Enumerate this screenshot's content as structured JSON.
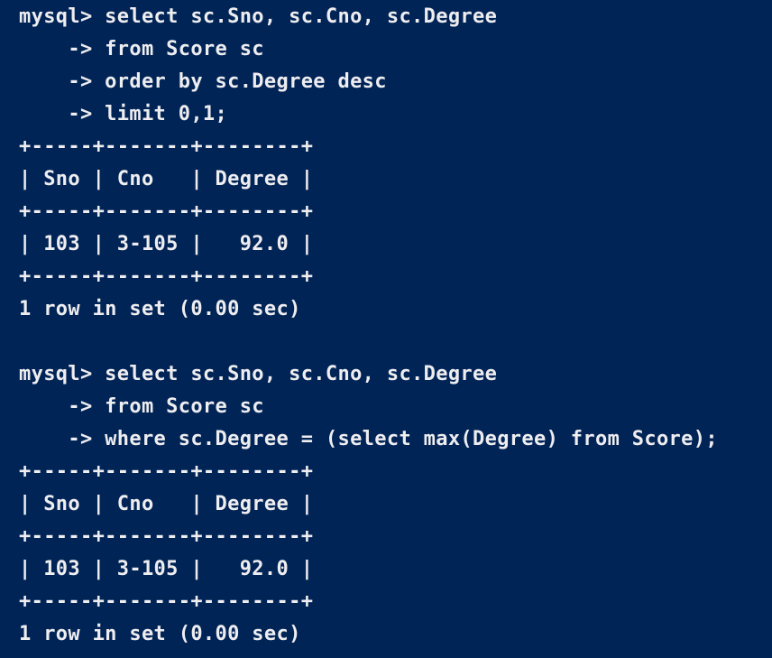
{
  "terminal": {
    "background": "#012456",
    "foreground": "#eeedf0",
    "lines": [
      "mysql> select sc.Sno, sc.Cno, sc.Degree",
      "    -> from Score sc",
      "    -> order by sc.Degree desc",
      "    -> limit 0,1;",
      "+-----+-------+--------+",
      "| Sno | Cno   | Degree |",
      "+-----+-------+--------+",
      "| 103 | 3-105 |   92.0 |",
      "+-----+-------+--------+",
      "1 row in set (0.00 sec)",
      "",
      "mysql> select sc.Sno, sc.Cno, sc.Degree",
      "    -> from Score sc",
      "    -> where sc.Degree = (select max(Degree) from Score);",
      "+-----+-------+--------+",
      "| Sno | Cno   | Degree |",
      "+-----+-------+--------+",
      "| 103 | 3-105 |   92.0 |",
      "+-----+-------+--------+",
      "1 row in set (0.00 sec)"
    ]
  }
}
